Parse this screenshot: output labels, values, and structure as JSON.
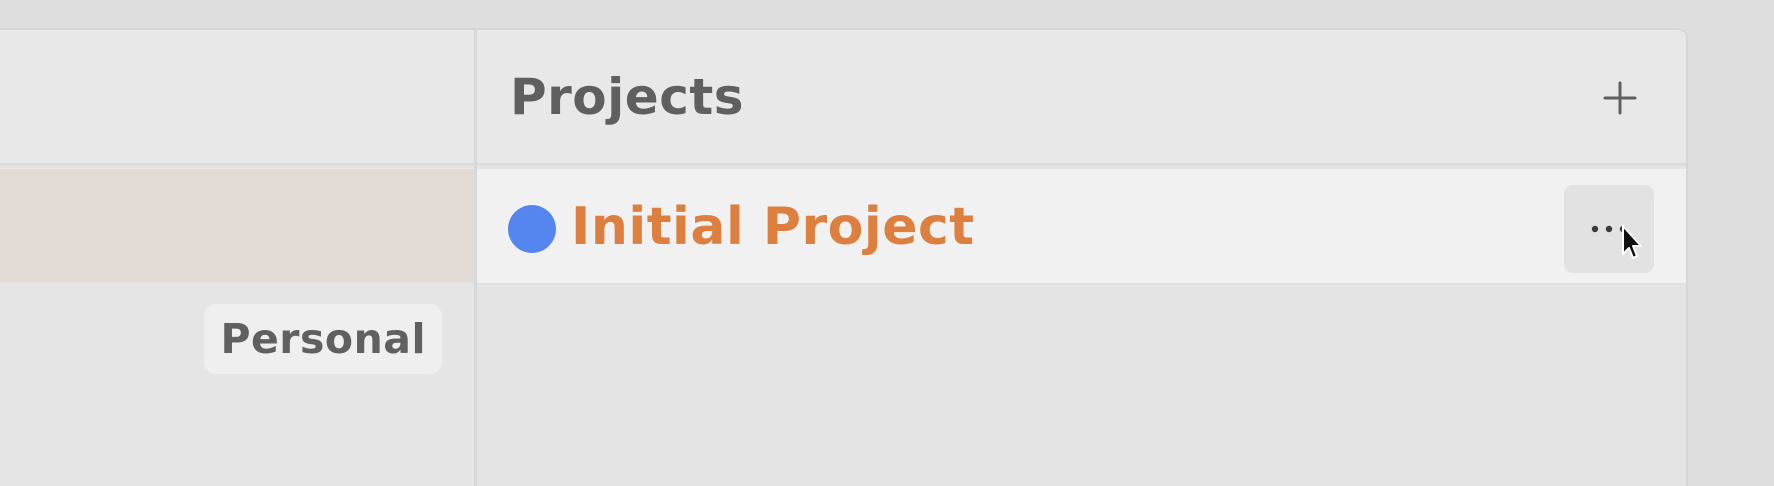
{
  "left_panel": {
    "tag_label": "Personal"
  },
  "projects": {
    "title": "Projects",
    "add_icon": "plus-icon",
    "items": [
      {
        "name": "Initial Project",
        "dot_color": "#5586ef",
        "name_color": "#dd7f3f",
        "menu_icon": "ellipsis-icon"
      }
    ]
  },
  "colors": {
    "accent": "#dd7f3f",
    "project_dot": "#5586ef",
    "selected_row": "#e3dbd6"
  }
}
